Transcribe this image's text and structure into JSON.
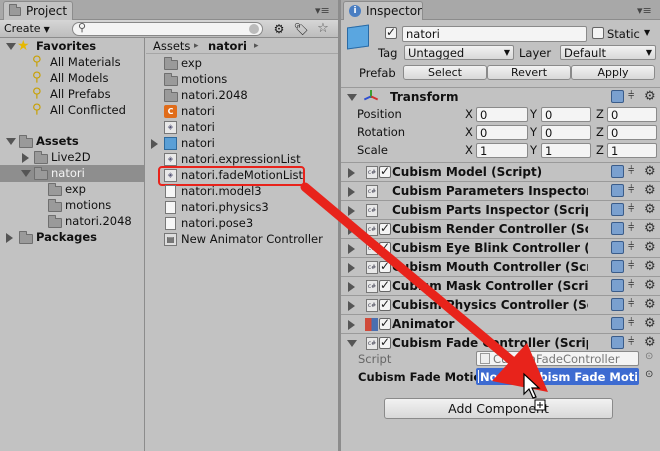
{
  "project": {
    "tab_title": "Project",
    "create_label": "Create",
    "search_placeholder": "",
    "favorites": {
      "label": "Favorites",
      "items": [
        "All Materials",
        "All Models",
        "All Prefabs",
        "All Conflicted"
      ]
    },
    "assets": {
      "label": "Assets",
      "items": [
        "Live2D",
        "natori"
      ],
      "natori_children": [
        "exp",
        "motions",
        "natori.2048"
      ]
    },
    "packages_label": "Packages",
    "breadcrumb": [
      "Assets",
      "natori"
    ],
    "files": [
      "exp",
      "motions",
      "natori.2048",
      "natori",
      "natori",
      "natori",
      "natori.expressionList",
      "natori.fadeMotionList",
      "natori.model3",
      "natori.physics3",
      "natori.pose3",
      "New Animator Controller"
    ],
    "highlight_color": "#e8231b"
  },
  "inspector": {
    "tab_title": "Inspector",
    "object_name": "natori",
    "static_label": "Static",
    "tag_label": "Tag",
    "tag_value": "Untagged",
    "layer_label": "Layer",
    "layer_value": "Default",
    "prefab_label": "Prefab",
    "prefab_buttons": [
      "Select",
      "Revert",
      "Apply"
    ],
    "transform": {
      "title": "Transform",
      "rows": [
        {
          "label": "Position",
          "x": "0",
          "y": "0",
          "z": "0"
        },
        {
          "label": "Rotation",
          "x": "0",
          "y": "0",
          "z": "0"
        },
        {
          "label": "Scale",
          "x": "1",
          "y": "1",
          "z": "1"
        }
      ],
      "axis": [
        "X",
        "Y",
        "Z"
      ]
    },
    "components": [
      "Cubism Model (Script)",
      "Cubism Parameters Inspector",
      "Cubism Parts Inspector (Scrip",
      "Cubism Render Controller (Scr",
      "Cubism Eye Blink Controller (S",
      "Cubism Mouth Controller (Scri",
      "Cubism Mask Controller (Scrip",
      "Cubism Physics Controller (Sc",
      "Animator",
      "Cubism Fade Controller (Scrip"
    ],
    "fade": {
      "script_label": "Script",
      "script_value": "CubismFadeController",
      "field_label": "Cubism Fade Motio",
      "field_value": "None (Cubism Fade Moti"
    },
    "add_component": "Add Component"
  }
}
